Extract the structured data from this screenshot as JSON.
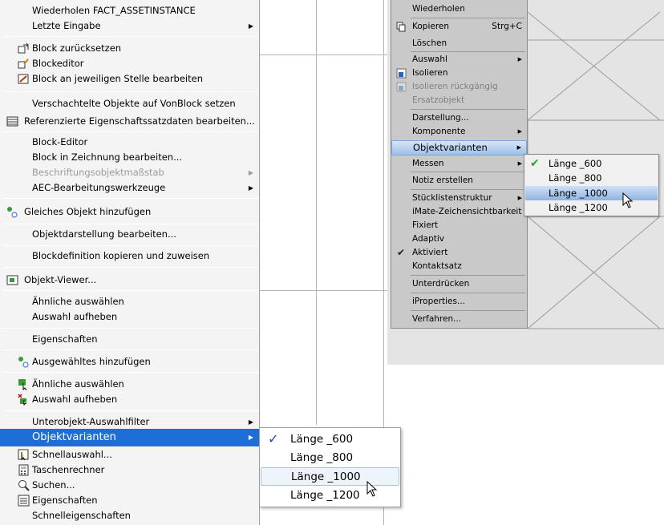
{
  "left_menu": {
    "items": [
      {
        "label": "Wiederholen FACT_ASSETINSTANCE"
      },
      {
        "label": "Letzte Eingabe",
        "arrow": "▶"
      },
      {
        "label": "Block zurücksetzen"
      },
      {
        "label": "Blockeditor"
      },
      {
        "label": "Block an jeweiligen Stelle bearbeiten"
      },
      {
        "label": "Verschachtelte Objekte auf VonBlock setzen"
      },
      {
        "label": "Referenzierte Eigenschaftssatzdaten bearbeiten..."
      },
      {
        "label": "Block-Editor"
      },
      {
        "label": "Block in Zeichnung bearbeiten..."
      },
      {
        "label": "Beschriftungsobjektmaßstab",
        "arrow": "▶"
      },
      {
        "label": "AEC-Bearbeitungswerkzeuge",
        "arrow": "▶"
      },
      {
        "label": "Gleiches Objekt hinzufügen"
      },
      {
        "label": "Objektdarstellung bearbeiten..."
      },
      {
        "label": "Blockdefinition kopieren und zuweisen"
      },
      {
        "label": "Objekt-Viewer..."
      },
      {
        "label": "Ähnliche auswählen"
      },
      {
        "label": "Auswahl aufheben"
      },
      {
        "label": "Eigenschaften"
      },
      {
        "label": "Ausgewähltes hinzufügen"
      },
      {
        "label": "Ähnliche auswählen"
      },
      {
        "label": "Auswahl aufheben"
      },
      {
        "label": "Unterobjekt-Auswahlfilter",
        "arrow": "▶"
      },
      {
        "label": "Objektvarianten",
        "arrow": "▶"
      },
      {
        "label": "Schnellauswahl..."
      },
      {
        "label": "Taschenrechner"
      },
      {
        "label": "Suchen..."
      },
      {
        "label": "Eigenschaften"
      },
      {
        "label": "Schnelleigenschaften"
      }
    ]
  },
  "left_submenu": {
    "items": [
      {
        "label": "Länge _600",
        "checked": "✓"
      },
      {
        "label": "Länge _800"
      },
      {
        "label": "Länge _1000"
      },
      {
        "label": "Länge _1200"
      }
    ]
  },
  "right_menu": {
    "items": [
      {
        "label": "Wiederholen"
      },
      {
        "label": "Kopieren",
        "shortcut": "Strg+C"
      },
      {
        "label": "Löschen"
      },
      {
        "label": "Auswahl",
        "arrow": "▶"
      },
      {
        "label": "Isolieren"
      },
      {
        "label": "Isolieren rückgängig"
      },
      {
        "label": "Ersatzobjekt"
      },
      {
        "label": "Darstellung..."
      },
      {
        "label": "Komponente",
        "arrow": "▶"
      },
      {
        "label": "Objektvarianten",
        "arrow": "▶"
      },
      {
        "label": "Messen",
        "arrow": "▶"
      },
      {
        "label": "Notiz erstellen"
      },
      {
        "label": "Stücklistenstruktur",
        "arrow": "▶"
      },
      {
        "label": "iMate-Zeichensichtbarkeit"
      },
      {
        "label": "Fixiert"
      },
      {
        "label": "Adaptiv"
      },
      {
        "label": "Aktiviert",
        "checked": "✔"
      },
      {
        "label": "Kontaktsatz"
      },
      {
        "label": "Unterdrücken"
      },
      {
        "label": "iProperties..."
      },
      {
        "label": "Verfahren..."
      }
    ]
  },
  "right_submenu": {
    "items": [
      {
        "label": "Länge _600",
        "checked": "✔"
      },
      {
        "label": "Länge _800"
      },
      {
        "label": "Länge _1000"
      },
      {
        "label": "Länge _1200"
      }
    ]
  },
  "colors": {
    "highlight_blue": "#1e6ed8",
    "check_blue": "#1b3fb0",
    "check_green": "#2aa02a"
  }
}
